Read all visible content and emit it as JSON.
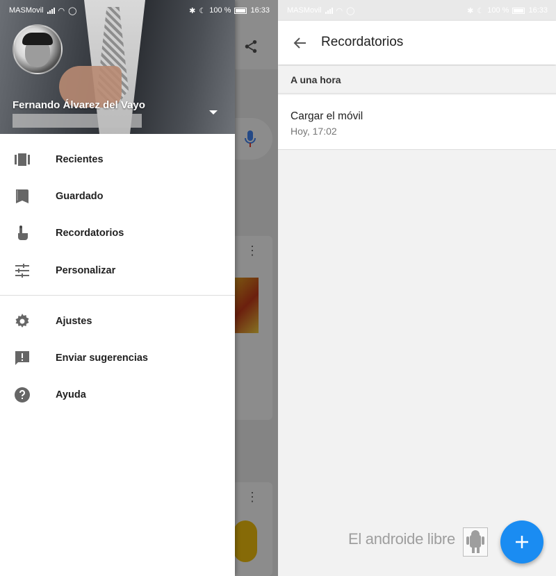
{
  "left_screen": {
    "status_bar": {
      "carrier": "MASMovil",
      "battery": "100 %",
      "time": "16:33"
    },
    "drawer": {
      "user_name": "Fernando Álvarez del Vayo",
      "primary_items": [
        {
          "label": "Recientes",
          "icon": "recent-cards-icon"
        },
        {
          "label": "Guardado",
          "icon": "bookmark-icon"
        },
        {
          "label": "Recordatorios",
          "icon": "reminder-hand-icon"
        },
        {
          "label": "Personalizar",
          "icon": "tune-sliders-icon"
        }
      ],
      "secondary_items": [
        {
          "label": "Ajustes",
          "icon": "gear-icon"
        },
        {
          "label": "Enviar sugerencias",
          "icon": "feedback-icon"
        },
        {
          "label": "Ayuda",
          "icon": "help-icon"
        }
      ]
    }
  },
  "right_screen": {
    "status_bar": {
      "carrier": "MASMovil",
      "battery": "100 %",
      "time": "16:33"
    },
    "app_bar": {
      "title": "Recordatorios"
    },
    "section": {
      "header": "A una hora"
    },
    "reminders": [
      {
        "title": "Cargar el móvil",
        "time": "Hoy, 17:02"
      }
    ],
    "watermark": "El androide libre",
    "colors": {
      "fab": "#1a8cf2",
      "mic_blue": "#4285f4",
      "mic_red": "#ea4335"
    }
  }
}
